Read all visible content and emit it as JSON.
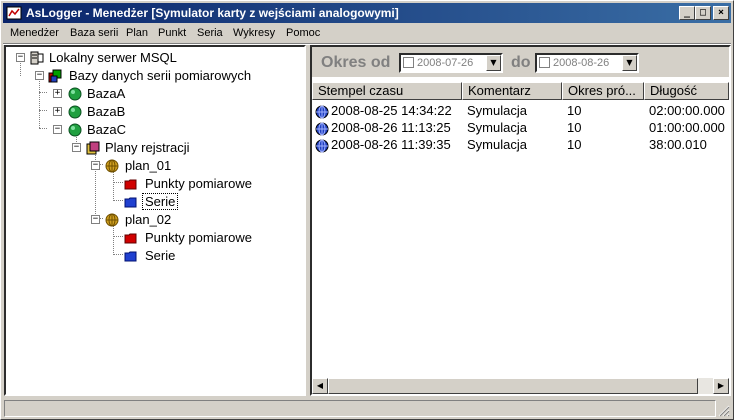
{
  "window": {
    "title": "AsLogger - Menedżer [Symulator karty z wejściami analogowymi]",
    "minimize_glyph": "_",
    "maximize_glyph": "□",
    "close_glyph": "×"
  },
  "menu": [
    {
      "label": "Menedżer"
    },
    {
      "label": "Baza serii"
    },
    {
      "label": "Plan"
    },
    {
      "label": "Punkt"
    },
    {
      "label": "Seria"
    },
    {
      "label": "Wykresy"
    },
    {
      "label": "Pomoc"
    }
  ],
  "tree": {
    "nodes": [
      {
        "label": "Lokalny serwer MSQL",
        "icon": "server-icon",
        "expanded": true
      },
      {
        "label": "Bazy danych serii pomiarowych",
        "icon": "databases-icon",
        "expanded": true
      },
      {
        "label": "BazaA",
        "icon": "database-green-icon",
        "expanded": false
      },
      {
        "label": "BazaB",
        "icon": "database-green-icon",
        "expanded": false
      },
      {
        "label": "BazaC",
        "icon": "database-green-icon",
        "expanded": true
      },
      {
        "label": "Plany rejstracji",
        "icon": "folder-plans-icon",
        "expanded": true
      },
      {
        "label": "plan_01",
        "icon": "plan-globe-icon",
        "expanded": true
      },
      {
        "label": "Punkty pomiarowe",
        "icon": "red-folder-icon"
      },
      {
        "label": "Serie",
        "icon": "blue-folder-icon",
        "selected": true
      },
      {
        "label": "plan_02",
        "icon": "plan-globe-icon",
        "expanded": true
      },
      {
        "label": "Punkty pomiarowe",
        "icon": "red-folder-icon"
      },
      {
        "label": "Serie",
        "icon": "blue-folder-icon"
      }
    ]
  },
  "filter": {
    "from_label": "Okres od",
    "from_value": "2008-07-26",
    "to_label": "do",
    "to_value": "2008-08-26"
  },
  "grid": {
    "columns": [
      "Stempel czasu",
      "Komentarz",
      "Okres pró...",
      "Długość"
    ],
    "rows": [
      {
        "timestamp": "2008-08-25 14:34:22",
        "comment": "Symulacja",
        "period": "10",
        "length": "02:00:00.000"
      },
      {
        "timestamp": "2008-08-26 11:13:25",
        "comment": "Symulacja",
        "period": "10",
        "length": "01:00:00.000"
      },
      {
        "timestamp": "2008-08-26 11:39:35",
        "comment": "Symulacja",
        "period": "10",
        "length": "38:00.010"
      }
    ]
  },
  "colors": {
    "title_start": "#0a246a",
    "title_end": "#3a6ea5",
    "face": "#d4d0c8"
  }
}
